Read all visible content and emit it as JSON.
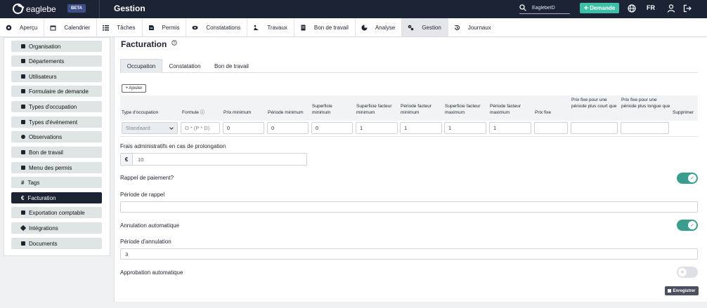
{
  "header": {
    "brand": "eaglebe",
    "beta": "BETA",
    "title": "Gestion",
    "search_placeholder": "EaglebeID",
    "request_button": "Demande",
    "language": "FR"
  },
  "nav": {
    "items": [
      {
        "label": "Aperçu",
        "icon": "dashboard-icon"
      },
      {
        "label": "Calendrier",
        "icon": "calendar-icon"
      },
      {
        "label": "Tâches",
        "icon": "tasks-icon"
      },
      {
        "label": "Permis",
        "icon": "permit-icon"
      },
      {
        "label": "Constatations",
        "icon": "eye-icon"
      },
      {
        "label": "Travaux",
        "icon": "works-icon"
      },
      {
        "label": "Bon de travail",
        "icon": "document-icon"
      },
      {
        "label": "Analyse",
        "icon": "analysis-icon"
      },
      {
        "label": "Gestion",
        "icon": "settings-icon"
      },
      {
        "label": "Journaux",
        "icon": "history-icon"
      }
    ],
    "active": "Gestion"
  },
  "sidebar": {
    "items": [
      {
        "label": "Organisation",
        "icon": "building-icon"
      },
      {
        "label": "Départements",
        "icon": "departments-icon"
      },
      {
        "label": "Utilisateurs",
        "icon": "users-icon"
      },
      {
        "label": "Formulaire de demande",
        "icon": "form-icon"
      },
      {
        "label": "Types d'occupation",
        "icon": "occupation-icon"
      },
      {
        "label": "Types d'événement",
        "icon": "event-icon"
      },
      {
        "label": "Observations",
        "icon": "eye-icon"
      },
      {
        "label": "Bon de travail",
        "icon": "document-icon"
      },
      {
        "label": "Menu des permis",
        "icon": "menu-icon"
      },
      {
        "label": "Tags",
        "icon": "hash-icon"
      },
      {
        "label": "Facturation",
        "icon": "euro-icon"
      },
      {
        "label": "Exportation comptable",
        "icon": "export-icon"
      },
      {
        "label": "Intégrations",
        "icon": "link-icon"
      },
      {
        "label": "Documents",
        "icon": "folder-icon"
      }
    ],
    "active": "Facturation"
  },
  "main": {
    "title": "Facturation",
    "tabs": [
      {
        "label": "Occupation"
      },
      {
        "label": "Constatation"
      },
      {
        "label": "Bon de travail"
      }
    ],
    "active_tab": "Occupation",
    "add_button": "+ Ajouter",
    "table": {
      "headers": [
        "Type d'occupation",
        "Formule",
        "Prix minimum",
        "Période minimum",
        "Superficie minimum",
        "Superficie facteur minimum",
        "Période facteur minimum",
        "Superficie facteur maximum",
        "Période facteur maximum",
        "Prix fixe",
        "Prix fixe pour une période plus court que",
        "Prix fixe pour une période plus longue que",
        "Supprimer"
      ],
      "row": {
        "type": "Standaard",
        "formula_placeholder": "O * (P * D)",
        "prix_minimum": "0",
        "periode_minimum": "0",
        "superficie_minimum": "0",
        "superficie_facteur_minimum": "1",
        "periode_facteur_minimum": "1",
        "superficie_facteur_maximum": "1",
        "periode_facteur_maximum": "1",
        "prix_fixe": "",
        "prix_fixe_court": "",
        "prix_fixe_long": ""
      }
    },
    "frais_label": "Frais administratifs en cas de prolongation",
    "frais_currency": "€",
    "frais_value": "10",
    "rappel_label": "Rappel de paiement?",
    "rappel_on": true,
    "periode_rappel_label": "Période de rappel",
    "periode_rappel_value": "",
    "annulation_label": "Annulation automatique",
    "annulation_on": true,
    "periode_annulation_label": "Période d'annulation",
    "periode_annulation_value": "3",
    "approbation_label": "Approbation automatique",
    "approbation_on": false,
    "save_button": "Enregistrer"
  },
  "colors": {
    "header_bg": "#1c2335",
    "accent": "#3cc0a6",
    "toggle_on": "#3a9d8e",
    "sidebar_item_bg": "#dfe5e4"
  }
}
